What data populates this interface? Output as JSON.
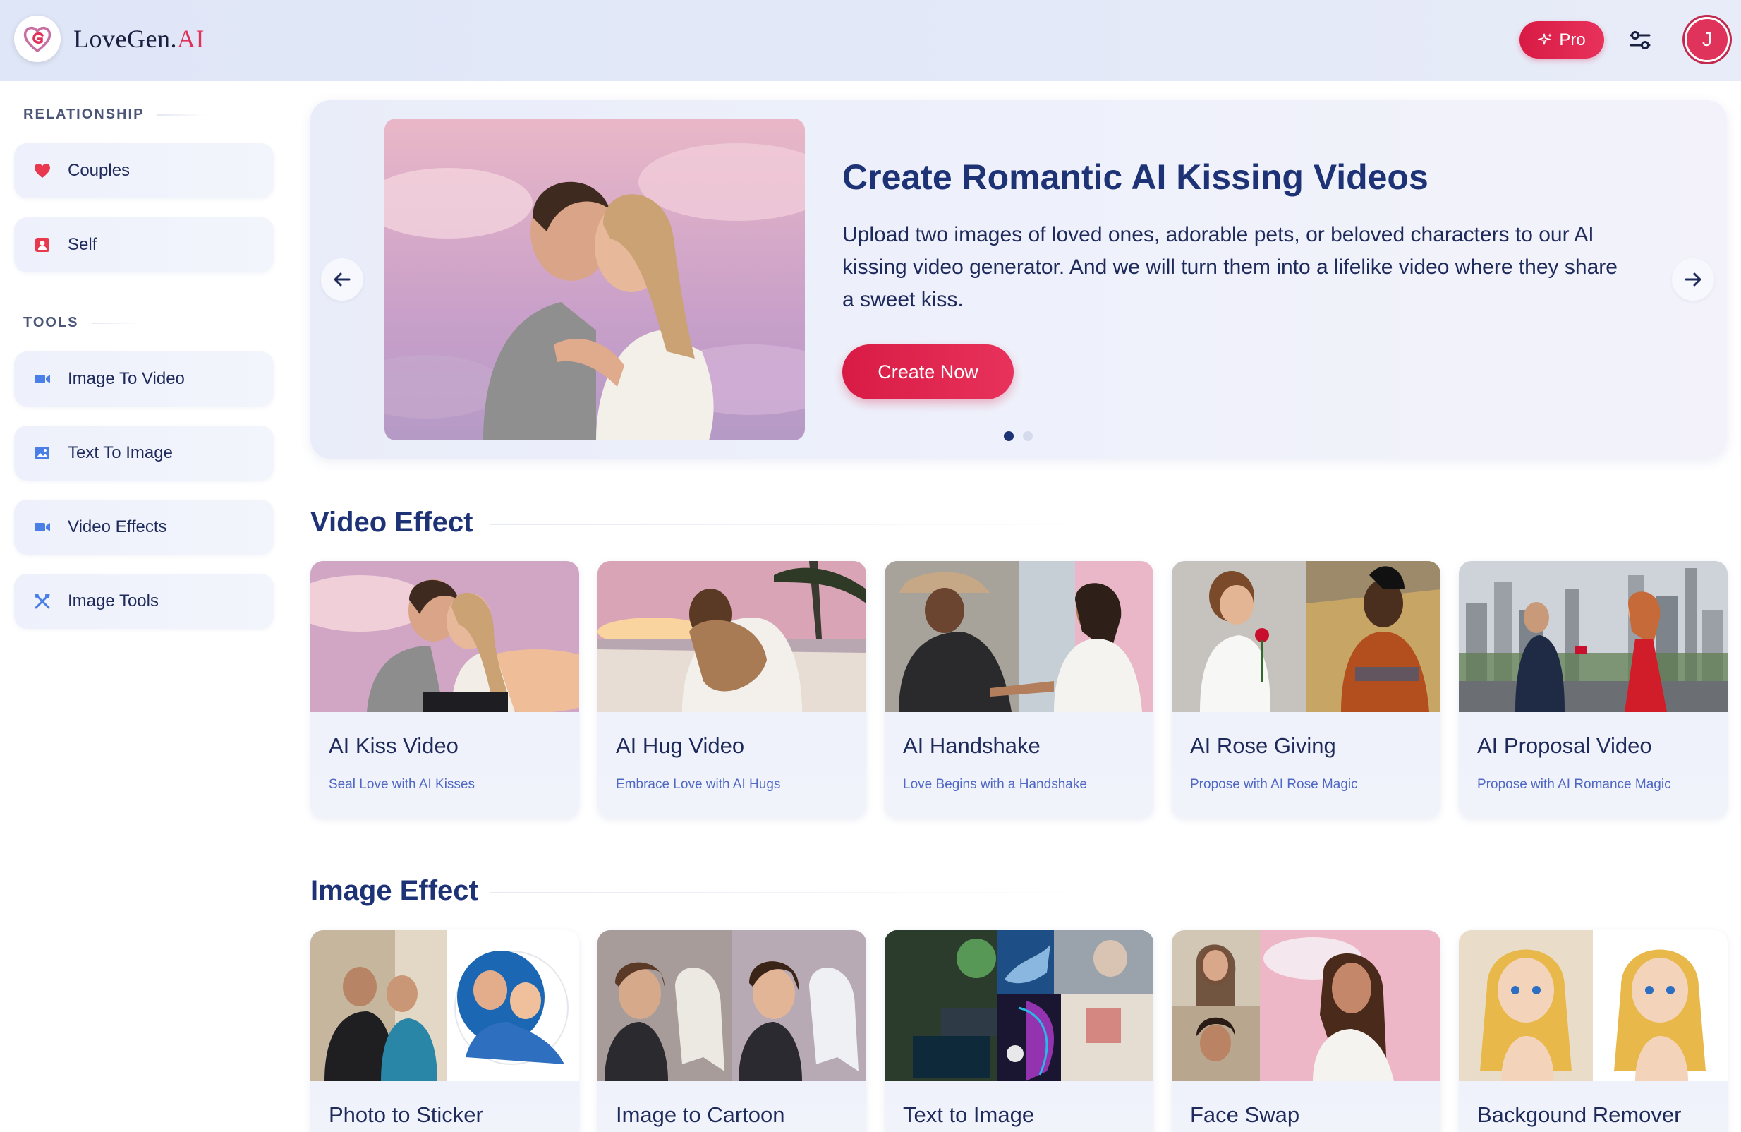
{
  "header": {
    "brand_main": "LoveGen.",
    "brand_ai": "AI",
    "pro_label": "Pro",
    "avatar_initial": "J"
  },
  "sidebar": {
    "sections": [
      {
        "title": "RELATIONSHIP",
        "items": [
          {
            "label": "Couples",
            "icon": "heart-icon"
          },
          {
            "label": "Self",
            "icon": "person-card-icon"
          }
        ]
      },
      {
        "title": "TOOLS",
        "items": [
          {
            "label": "Image To Video",
            "icon": "video-camera-icon"
          },
          {
            "label": "Text To Image",
            "icon": "image-icon"
          },
          {
            "label": "Video Effects",
            "icon": "video-camera-icon"
          },
          {
            "label": "Image Tools",
            "icon": "tools-icon"
          }
        ]
      }
    ]
  },
  "hero": {
    "title": "Create Romantic AI Kissing Videos",
    "description": "Upload two images of loved ones, adorable pets, or beloved characters to our AI kissing video generator. And we will turn them into a lifelike video where they share a sweet kiss.",
    "cta": "Create Now",
    "slides": 2,
    "active_slide": 1
  },
  "video_effect": {
    "title": "Video Effect",
    "cards": [
      {
        "title": "AI Kiss Video",
        "subtitle": "Seal Love with AI Kisses"
      },
      {
        "title": "AI Hug Video",
        "subtitle": "Embrace Love with AI Hugs"
      },
      {
        "title": "AI Handshake",
        "subtitle": "Love Begins with a Handshake"
      },
      {
        "title": "AI Rose Giving",
        "subtitle": "Propose with AI Rose Magic"
      },
      {
        "title": "AI Proposal Video",
        "subtitle": "Propose with AI Romance Magic"
      }
    ]
  },
  "image_effect": {
    "title": "Image Effect",
    "cards": [
      {
        "title": "Photo to Sticker"
      },
      {
        "title": "Image to Cartoon"
      },
      {
        "title": "Text to Image"
      },
      {
        "title": "Face Swap"
      },
      {
        "title": "Backgound Remover"
      }
    ]
  },
  "colors": {
    "accent": "#e0335b",
    "heading": "#1e3276",
    "subtitle": "#4e68c4"
  }
}
